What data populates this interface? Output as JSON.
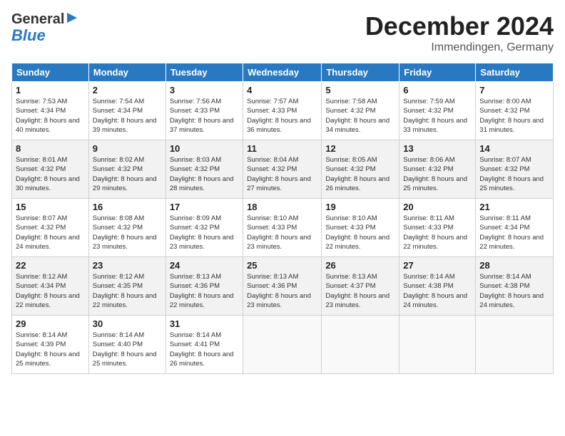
{
  "header": {
    "logo_general": "General",
    "logo_blue": "Blue",
    "month_title": "December 2024",
    "location": "Immendingen, Germany"
  },
  "days_of_week": [
    "Sunday",
    "Monday",
    "Tuesday",
    "Wednesday",
    "Thursday",
    "Friday",
    "Saturday"
  ],
  "weeks": [
    [
      {
        "day": "1",
        "sunrise": "Sunrise: 7:53 AM",
        "sunset": "Sunset: 4:34 PM",
        "daylight": "Daylight: 8 hours and 40 minutes."
      },
      {
        "day": "2",
        "sunrise": "Sunrise: 7:54 AM",
        "sunset": "Sunset: 4:34 PM",
        "daylight": "Daylight: 8 hours and 39 minutes."
      },
      {
        "day": "3",
        "sunrise": "Sunrise: 7:56 AM",
        "sunset": "Sunset: 4:33 PM",
        "daylight": "Daylight: 8 hours and 37 minutes."
      },
      {
        "day": "4",
        "sunrise": "Sunrise: 7:57 AM",
        "sunset": "Sunset: 4:33 PM",
        "daylight": "Daylight: 8 hours and 36 minutes."
      },
      {
        "day": "5",
        "sunrise": "Sunrise: 7:58 AM",
        "sunset": "Sunset: 4:32 PM",
        "daylight": "Daylight: 8 hours and 34 minutes."
      },
      {
        "day": "6",
        "sunrise": "Sunrise: 7:59 AM",
        "sunset": "Sunset: 4:32 PM",
        "daylight": "Daylight: 8 hours and 33 minutes."
      },
      {
        "day": "7",
        "sunrise": "Sunrise: 8:00 AM",
        "sunset": "Sunset: 4:32 PM",
        "daylight": "Daylight: 8 hours and 31 minutes."
      }
    ],
    [
      {
        "day": "8",
        "sunrise": "Sunrise: 8:01 AM",
        "sunset": "Sunset: 4:32 PM",
        "daylight": "Daylight: 8 hours and 30 minutes."
      },
      {
        "day": "9",
        "sunrise": "Sunrise: 8:02 AM",
        "sunset": "Sunset: 4:32 PM",
        "daylight": "Daylight: 8 hours and 29 minutes."
      },
      {
        "day": "10",
        "sunrise": "Sunrise: 8:03 AM",
        "sunset": "Sunset: 4:32 PM",
        "daylight": "Daylight: 8 hours and 28 minutes."
      },
      {
        "day": "11",
        "sunrise": "Sunrise: 8:04 AM",
        "sunset": "Sunset: 4:32 PM",
        "daylight": "Daylight: 8 hours and 27 minutes."
      },
      {
        "day": "12",
        "sunrise": "Sunrise: 8:05 AM",
        "sunset": "Sunset: 4:32 PM",
        "daylight": "Daylight: 8 hours and 26 minutes."
      },
      {
        "day": "13",
        "sunrise": "Sunrise: 8:06 AM",
        "sunset": "Sunset: 4:32 PM",
        "daylight": "Daylight: 8 hours and 25 minutes."
      },
      {
        "day": "14",
        "sunrise": "Sunrise: 8:07 AM",
        "sunset": "Sunset: 4:32 PM",
        "daylight": "Daylight: 8 hours and 25 minutes."
      }
    ],
    [
      {
        "day": "15",
        "sunrise": "Sunrise: 8:07 AM",
        "sunset": "Sunset: 4:32 PM",
        "daylight": "Daylight: 8 hours and 24 minutes."
      },
      {
        "day": "16",
        "sunrise": "Sunrise: 8:08 AM",
        "sunset": "Sunset: 4:32 PM",
        "daylight": "Daylight: 8 hours and 23 minutes."
      },
      {
        "day": "17",
        "sunrise": "Sunrise: 8:09 AM",
        "sunset": "Sunset: 4:32 PM",
        "daylight": "Daylight: 8 hours and 23 minutes."
      },
      {
        "day": "18",
        "sunrise": "Sunrise: 8:10 AM",
        "sunset": "Sunset: 4:33 PM",
        "daylight": "Daylight: 8 hours and 23 minutes."
      },
      {
        "day": "19",
        "sunrise": "Sunrise: 8:10 AM",
        "sunset": "Sunset: 4:33 PM",
        "daylight": "Daylight: 8 hours and 22 minutes."
      },
      {
        "day": "20",
        "sunrise": "Sunrise: 8:11 AM",
        "sunset": "Sunset: 4:33 PM",
        "daylight": "Daylight: 8 hours and 22 minutes."
      },
      {
        "day": "21",
        "sunrise": "Sunrise: 8:11 AM",
        "sunset": "Sunset: 4:34 PM",
        "daylight": "Daylight: 8 hours and 22 minutes."
      }
    ],
    [
      {
        "day": "22",
        "sunrise": "Sunrise: 8:12 AM",
        "sunset": "Sunset: 4:34 PM",
        "daylight": "Daylight: 8 hours and 22 minutes."
      },
      {
        "day": "23",
        "sunrise": "Sunrise: 8:12 AM",
        "sunset": "Sunset: 4:35 PM",
        "daylight": "Daylight: 8 hours and 22 minutes."
      },
      {
        "day": "24",
        "sunrise": "Sunrise: 8:13 AM",
        "sunset": "Sunset: 4:36 PM",
        "daylight": "Daylight: 8 hours and 22 minutes."
      },
      {
        "day": "25",
        "sunrise": "Sunrise: 8:13 AM",
        "sunset": "Sunset: 4:36 PM",
        "daylight": "Daylight: 8 hours and 23 minutes."
      },
      {
        "day": "26",
        "sunrise": "Sunrise: 8:13 AM",
        "sunset": "Sunset: 4:37 PM",
        "daylight": "Daylight: 8 hours and 23 minutes."
      },
      {
        "day": "27",
        "sunrise": "Sunrise: 8:14 AM",
        "sunset": "Sunset: 4:38 PM",
        "daylight": "Daylight: 8 hours and 24 minutes."
      },
      {
        "day": "28",
        "sunrise": "Sunrise: 8:14 AM",
        "sunset": "Sunset: 4:38 PM",
        "daylight": "Daylight: 8 hours and 24 minutes."
      }
    ],
    [
      {
        "day": "29",
        "sunrise": "Sunrise: 8:14 AM",
        "sunset": "Sunset: 4:39 PM",
        "daylight": "Daylight: 8 hours and 25 minutes."
      },
      {
        "day": "30",
        "sunrise": "Sunrise: 8:14 AM",
        "sunset": "Sunset: 4:40 PM",
        "daylight": "Daylight: 8 hours and 25 minutes."
      },
      {
        "day": "31",
        "sunrise": "Sunrise: 8:14 AM",
        "sunset": "Sunset: 4:41 PM",
        "daylight": "Daylight: 8 hours and 26 minutes."
      },
      null,
      null,
      null,
      null
    ]
  ]
}
